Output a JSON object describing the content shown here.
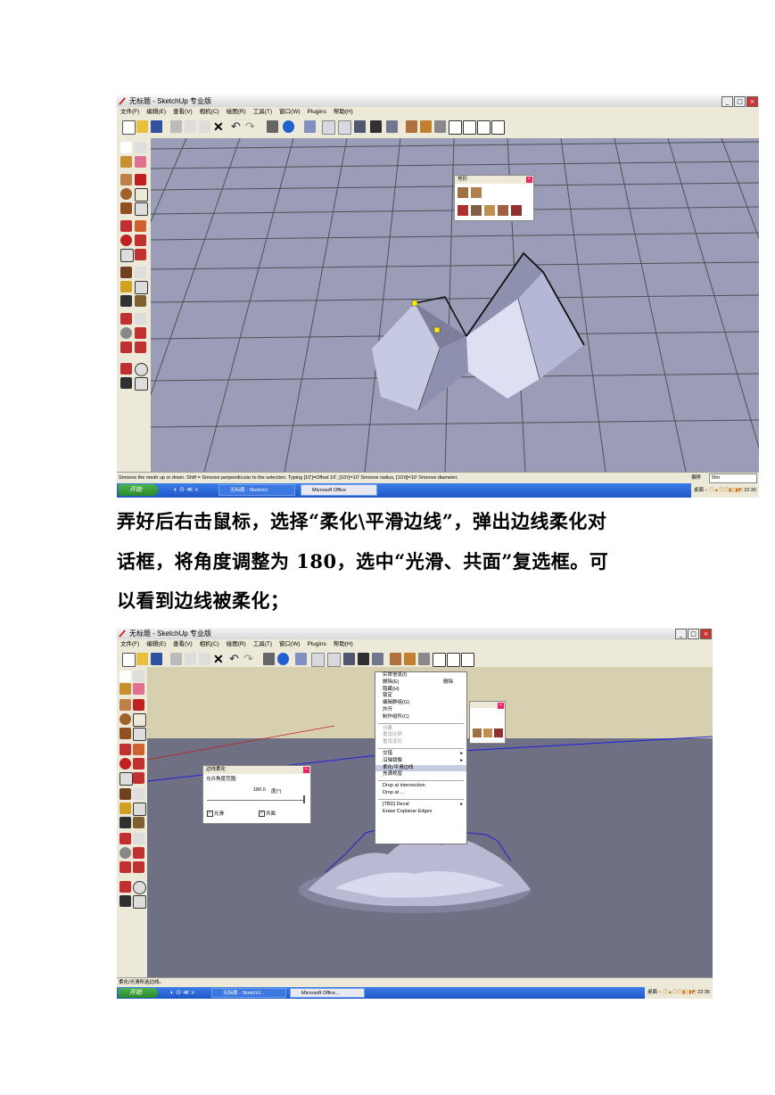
{
  "screenshot1": {
    "title": "无标题 - SketchUp 专业版",
    "menu": [
      "文件(F)",
      "编辑(E)",
      "查看(V)",
      "相机(C)",
      "绘图(R)",
      "工具(T)",
      "窗口(W)",
      "Plugins",
      "帮助(H)"
    ],
    "terrain_panel_title": "地形",
    "status_text": "Smoove the mesh up or down.  Shift = Smoove perpendicular to the selection.  Typing [10']=Offset 10',  [10'r]=10' Smoove radius,  [10'd]=10' Smoove diameter.",
    "measure_label": "偏移",
    "measure_value": "5fm",
    "taskbar": {
      "start_label": "开始",
      "items": [
        "无标题 - SketchU",
        "Microsoft Office"
      ],
      "tray_label": "桌面",
      "clock": "22:30"
    }
  },
  "paragraph": {
    "line1": "弄好后右击鼠标，选择“柔化\\平滑边线”，弹出边线柔化对",
    "line2": "话框，将角度调整为 180，选中“光滑、共面”复选框。可",
    "line3": "以看到边线被柔化；"
  },
  "screenshot2": {
    "title": "无标题 - SketchUp 专业版",
    "menu": [
      "文件(F)",
      "编辑(E)",
      "查看(V)",
      "相机(C)",
      "绘图(R)",
      "工具(T)",
      "窗口(W)",
      "Plugins",
      "帮助(H)"
    ],
    "soften_dialog": {
      "title": "边线柔化",
      "angle_label": "允许角度范围:",
      "angle_value": "180.0",
      "angle_unit": "度(°)",
      "smooth_label": "光滑",
      "coplanar_label": "共面",
      "smooth_checked": true,
      "coplanar_checked": true
    },
    "context_menu": [
      {
        "label": "实体信息(I)",
        "right": ""
      },
      {
        "label": "删除(E)",
        "right": "删除"
      },
      {
        "label": "隐藏(H)",
        "right": ""
      },
      {
        "label": "锁定",
        "right": ""
      },
      {
        "label": "编辑群组(G)",
        "right": ""
      },
      {
        "label": "炸开",
        "right": ""
      },
      {
        "label": "制作组件(C)",
        "right": ""
      },
      {
        "label": "-"
      },
      {
        "label": "分离",
        "disabled": true
      },
      {
        "label": "重设比例",
        "disabled": true
      },
      {
        "label": "重设变形",
        "disabled": true
      },
      {
        "label": "-"
      },
      {
        "label": "交错",
        "submenu": true
      },
      {
        "label": "沿轴镜像",
        "submenu": true
      },
      {
        "label": "柔化/平滑边线",
        "highlight": true
      },
      {
        "label": "充满视窗"
      },
      {
        "label": "-"
      },
      {
        "label": "Drop at intersection"
      },
      {
        "label": "Drop at ..."
      },
      {
        "label": "-"
      },
      {
        "label": "[TBD] Decal",
        "submenu": true
      },
      {
        "label": "Erase Coplanar Edges"
      }
    ],
    "status_text": "柔化/光滑所选边线。",
    "taskbar": {
      "start_label": "开始",
      "items": [
        "无标题 - SketchU...",
        "Microsoft Office..."
      ],
      "tray_label": "桌面",
      "clock": "22:35"
    }
  },
  "colors": {
    "ground": "#9a9cb8",
    "sky": "#d6d0b0",
    "ground2": "#6f7084",
    "taskbar": "#245edb",
    "start": "#3a9e3a"
  }
}
